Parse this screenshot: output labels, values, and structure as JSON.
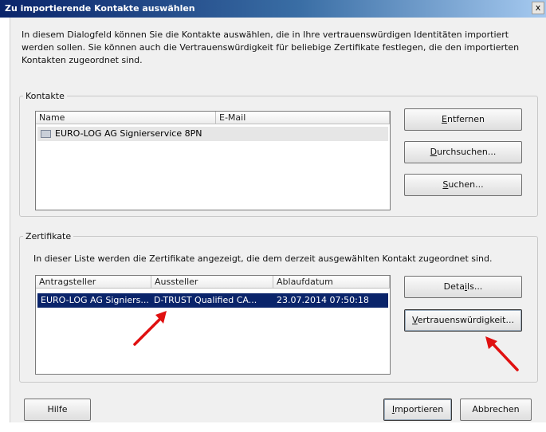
{
  "window": {
    "title": "Zu importierende Kontakte auswählen",
    "close": "x"
  },
  "intro_text": "In diesem Dialogfeld können Sie die Kontakte auswählen, die in Ihre vertrauenswürdigen Identitäten importiert werden sollen. Sie können auch die Vertrauenswürdigkeit für beliebige Zertifikate festlegen, die den importierten Kontakten zugeordnet sind.",
  "contacts": {
    "group_label": "Kontakte",
    "columns": [
      "Name",
      "E-Mail"
    ],
    "rows": [
      {
        "name": "EURO-LOG AG Signierservice 8PN",
        "email": ""
      }
    ],
    "buttons": {
      "remove": {
        "key": "E",
        "rest": "ntfernen"
      },
      "browse": {
        "key": "D",
        "rest": "urchsuchen..."
      },
      "search": {
        "key": "S",
        "rest": "uchen..."
      }
    }
  },
  "certificates": {
    "group_label": "Zertifikate",
    "description": "In dieser Liste werden die Zertifikate angezeigt, die dem derzeit ausgewählten Kontakt zugeordnet sind.",
    "columns": [
      "Antragsteller",
      "Aussteller",
      "Ablaufdatum"
    ],
    "rows": [
      {
        "subject": "EURO-LOG AG Signiers...",
        "issuer": "D-TRUST Qualified CA...",
        "expiry": "23.07.2014 07:50:18"
      }
    ],
    "buttons": {
      "details": {
        "pre": "Deta",
        "key": "i",
        "post": "ls..."
      },
      "trust": {
        "key": "V",
        "rest": "ertrauenswürdigkeit..."
      }
    }
  },
  "footer": {
    "help": "Hilfe",
    "import": {
      "key": "I",
      "rest": "mportieren"
    },
    "cancel": "Abbrechen"
  },
  "colors": {
    "selection": "#0a246a",
    "annotation_arrow": "#e01010"
  }
}
